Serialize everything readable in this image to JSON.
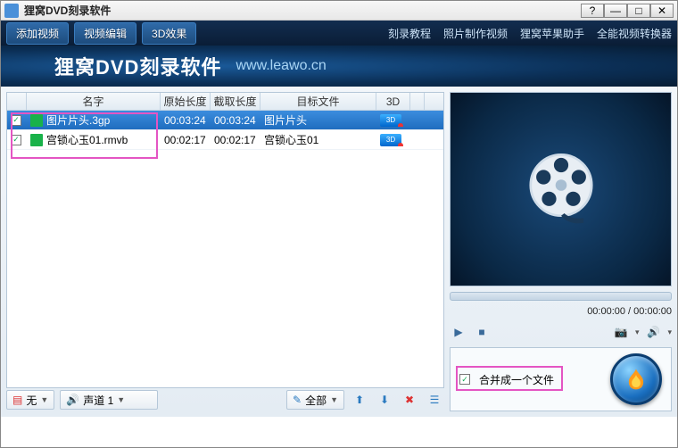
{
  "window": {
    "title": "狸窝DVD刻录软件"
  },
  "toolbar": {
    "add_video": "添加视频",
    "video_edit": "视频编辑",
    "effect_3d": "3D效果"
  },
  "links": {
    "burn_tutorial": "刻录教程",
    "photo_video": "照片制作视频",
    "apple_helper": "狸窝苹果助手",
    "converter": "全能视频转换器"
  },
  "banner": {
    "title": "狸窝DVD刻录软件",
    "url": "www.leawo.cn"
  },
  "columns": {
    "name": "名字",
    "orig_len": "原始长度",
    "cut_len": "截取长度",
    "target": "目标文件",
    "threeD": "3D"
  },
  "rows": [
    {
      "checked": true,
      "name": "图片片头.3gp",
      "orig": "00:03:24",
      "cut": "00:03:24",
      "target": "图片片头"
    },
    {
      "checked": true,
      "name": "宫锁心玉01.rmvb",
      "orig": "00:02:17",
      "cut": "00:02:17",
      "target": "宫锁心玉01"
    }
  ],
  "bottom": {
    "subtitle_none": "无",
    "audio_track": "声道 1",
    "all": "全部"
  },
  "preview": {
    "time": "00:00:00 / 00:00:00"
  },
  "merge": {
    "label": "合并成一个文件",
    "checked": true
  }
}
